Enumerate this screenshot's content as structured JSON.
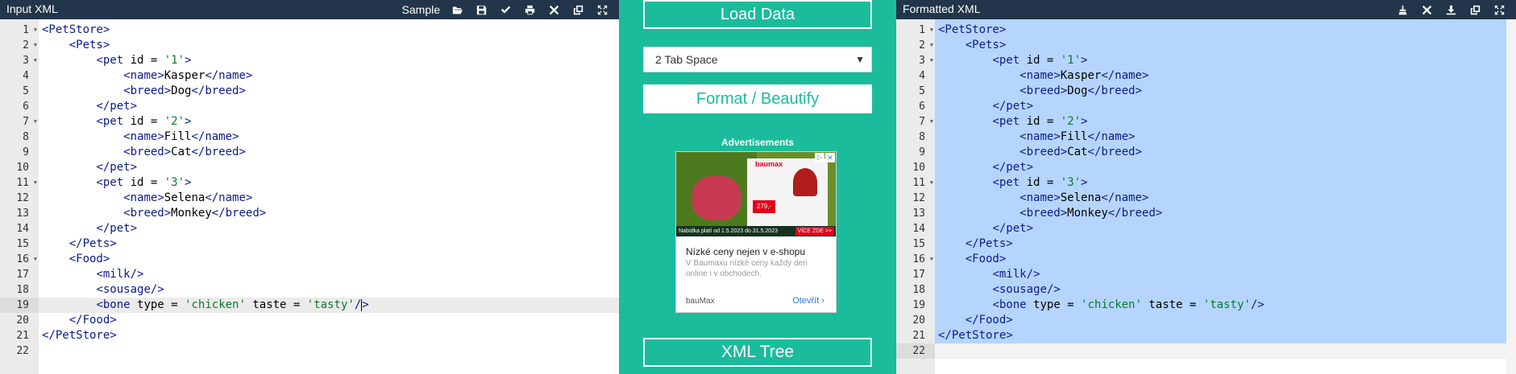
{
  "input_panel": {
    "title": "Input XML",
    "sample_label": "Sample",
    "tools": [
      "folder-open-icon",
      "save-icon",
      "check-icon",
      "print-icon",
      "close-icon",
      "copy-icon",
      "expand-icon"
    ]
  },
  "output_panel": {
    "title": "Formatted XML",
    "tools": [
      "broom-icon",
      "close-icon",
      "download-icon",
      "copy-icon",
      "expand-icon"
    ]
  },
  "middle": {
    "load_label": "Load Data",
    "tab_select": {
      "selected": "2 Tab Space"
    },
    "format_label": "Format / Beautify",
    "ads_label": "Advertisements",
    "tree_label": "XML Tree"
  },
  "ad": {
    "brand_logo": "baumax",
    "price": "279,-",
    "banner_text": "Nabídka platí od 1.5.2023 do 31.5.2023",
    "cta": "VÍCE ZDE >>",
    "headline": "Nízké ceny nejen v e-shopu",
    "description": "V Baumaxu nízké ceny každý den online i v obchodech.",
    "brand": "bauMax",
    "open_label": "Otevřít"
  },
  "input_lines": [
    "<PetStore>",
    "    <Pets>",
    "        <pet id = '1'>",
    "            <name>Kasper</name>",
    "            <breed>Dog</breed>",
    "        </pet>",
    "        <pet id = '2'>",
    "            <name>Fill</name>",
    "            <breed>Cat</breed>",
    "        </pet>",
    "        <pet id = '3'>",
    "            <name>Selena</name>",
    "            <breed>Monkey</breed>",
    "        </pet>",
    "    </Pets>",
    "    <Food>",
    "        <milk/>",
    "        <sousage/>",
    "        <bone type = 'chicken' taste = 'tasty'/>",
    "    </Food>",
    "</PetStore>",
    ""
  ],
  "output_lines": [
    "<PetStore>",
    "    <Pets>",
    "        <pet id = '1'>",
    "            <name>Kasper</name>",
    "            <breed>Dog</breed>",
    "        </pet>",
    "        <pet id = '2'>",
    "            <name>Fill</name>",
    "            <breed>Cat</breed>",
    "        </pet>",
    "        <pet id = '3'>",
    "            <name>Selena</name>",
    "            <breed>Monkey</breed>",
    "        </pet>",
    "    </Pets>",
    "    <Food>",
    "        <milk/>",
    "        <sousage/>",
    "        <bone type = 'chicken' taste = 'tasty'/>",
    "    </Food>",
    "</PetStore>",
    ""
  ],
  "fold_lines": [
    1,
    2,
    3,
    7,
    11,
    16
  ],
  "input_active_line": 19,
  "output_active_line": 22,
  "colors": {
    "header": "#22354a",
    "accent": "#1abc9c",
    "selection": "#b5d5ff",
    "gutter": "#ebebeb",
    "tag": "#0b1a8a",
    "attr_value": "#0a7a2a"
  }
}
